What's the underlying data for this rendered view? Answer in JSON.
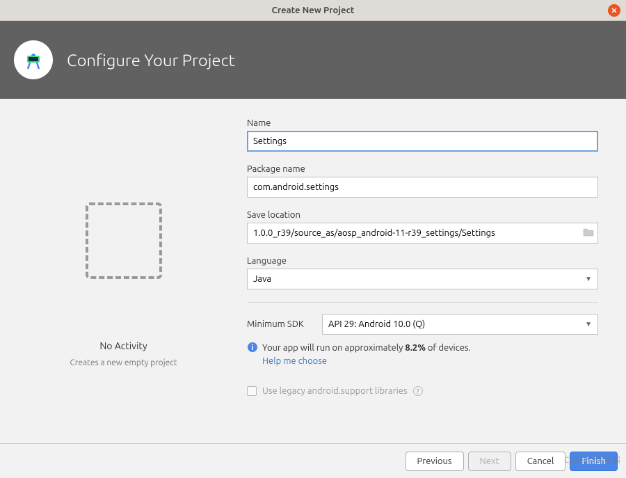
{
  "titlebar": {
    "title": "Create New Project"
  },
  "header": {
    "title": "Configure Your Project"
  },
  "left_panel": {
    "activity_name": "No Activity",
    "activity_desc": "Creates a new empty project"
  },
  "form": {
    "name_label": "Name",
    "name_value": "Settings",
    "package_label": "Package name",
    "package_value": "com.android.settings",
    "location_label": "Save location",
    "location_value": "1.0.0_r39/source_as/aosp_android-11-r39_settings/Settings",
    "language_label": "Language",
    "language_value": "Java",
    "sdk_label": "Minimum SDK",
    "sdk_value": "API 29: Android 10.0 (Q)",
    "info_prefix": "Your app will run on approximately ",
    "info_percent": "8.2%",
    "info_suffix": " of devices.",
    "help_link": "Help me choose",
    "legacy_label": "Use legacy android.support libraries"
  },
  "footer": {
    "previous": "Previous",
    "next": "Next",
    "cancel": "Cancel",
    "finish": "Finish"
  },
  "watermark": "CSDN @龔礼鹏"
}
